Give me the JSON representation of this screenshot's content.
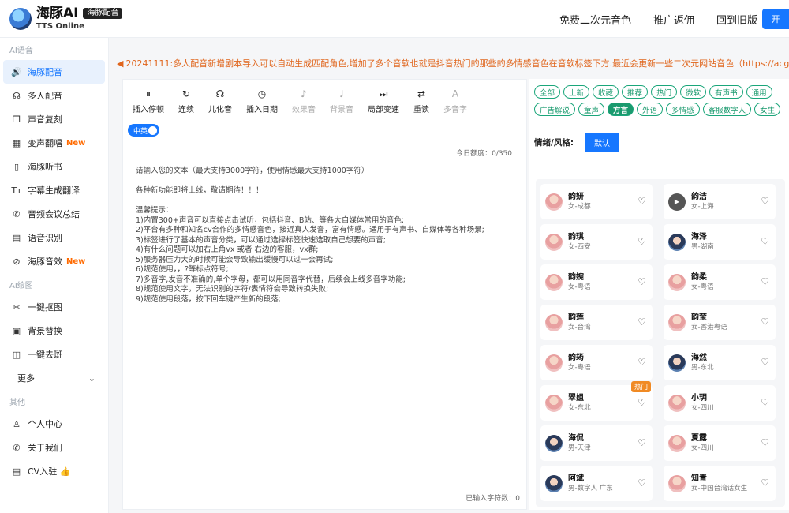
{
  "header": {
    "title": "海豚AI",
    "badge": "海豚配音",
    "subtitle": "TTS Online",
    "nav": [
      "免费二次元音色",
      "推广返佣",
      "回到旧版"
    ],
    "open_btn": "开"
  },
  "sidebar": {
    "sections": [
      {
        "title": "AI语音",
        "items": [
          {
            "label": "海豚配音",
            "icon": "🔊",
            "new": ""
          },
          {
            "label": "多人配音",
            "icon": "☊",
            "new": ""
          },
          {
            "label": "声音复刻",
            "icon": "❐",
            "new": ""
          },
          {
            "label": "变声翻唱",
            "icon": "▦",
            "new": "New"
          },
          {
            "label": "海豚听书",
            "icon": "▯",
            "new": ""
          },
          {
            "label": "字幕生成翻译",
            "icon": "Tт",
            "new": ""
          },
          {
            "label": "音频会议总结",
            "icon": "✆",
            "new": ""
          },
          {
            "label": "语音识别",
            "icon": "▤",
            "new": ""
          },
          {
            "label": "海豚音效",
            "icon": "⊘",
            "new": "New"
          }
        ]
      },
      {
        "title": "AI绘图",
        "items": [
          {
            "label": "一键抠图",
            "icon": "✂",
            "new": ""
          },
          {
            "label": "背景替换",
            "icon": "▣",
            "new": ""
          },
          {
            "label": "一键去斑",
            "icon": "◫",
            "new": ""
          }
        ]
      }
    ],
    "more_label": "更多",
    "other_title": "其他",
    "other_items": [
      {
        "label": "个人中心",
        "icon": "♙"
      },
      {
        "label": "关于我们",
        "icon": "✆"
      },
      {
        "label": "CV入驻 👍",
        "icon": "▤"
      }
    ]
  },
  "notice": "20241111:多人配音新增剧本导入可以自动生成匹配角色,增加了多个音软也就是抖音热门的那些的多情感音色在音软标签下方.最近会更新一些二次元网站音色（https://acgn.ttson.cn/），欢迎试用。",
  "toolbar": [
    {
      "icon": "⏸",
      "label": "插入停顿",
      "disabled": false
    },
    {
      "icon": "↻",
      "label": "连续",
      "disabled": false
    },
    {
      "icon": "☊",
      "label": "儿化音",
      "disabled": false
    },
    {
      "icon": "◷",
      "label": "插入日期",
      "disabled": false
    },
    {
      "icon": "♪",
      "label": "效果音",
      "disabled": true
    },
    {
      "icon": "♩",
      "label": "背景音",
      "disabled": true
    },
    {
      "icon": "⏭",
      "label": "局部变速",
      "disabled": false
    },
    {
      "icon": "⇄",
      "label": "重读",
      "disabled": false
    },
    {
      "icon": "A",
      "label": "多音字",
      "disabled": true
    }
  ],
  "switch_label": "中英",
  "quota": "今日额度：0/350",
  "textarea_content": "请输入您的文本（最大支持3000字符，使用情感最大支持1000字符）\n\n各种新功能即将上线，敬请期待！！！\n\n温馨提示：\n1)内置300+声音可以直接点击试听，包括抖音、B站、等各大自媒体常用的音色;\n2)平台有多种和知名cv合作的多情感音色，接近真人发音，富有情感。适用于有声书、自媒体等各种场景;\n3)标签进行了基本的声音分类，可以通过选择标签快速选取自己想要的声音;\n4)有什么问题可以加右上角vx 或者 右边的客服，vx群;\n5)服务器压力大的时候可能会导致输出缓慢可以过一会再试;\n6)规范使用，，?等标点符号;\n7)多音字,发音不准确的,单个字母，都可以用同音字代替，后续会上线多音字功能;\n8)规范使用文字，无法识别的字符/表情符会导致转换失败;\n9)规范使用段落，按下回车键产生新的段落;",
  "char_count": "已输入字符数：0",
  "tags": [
    {
      "label": "全部",
      "active": false
    },
    {
      "label": "上新",
      "active": false
    },
    {
      "label": "收藏",
      "active": false
    },
    {
      "label": "推荐",
      "active": false
    },
    {
      "label": "热门",
      "active": false
    },
    {
      "label": "微软",
      "active": false
    },
    {
      "label": "有声书",
      "active": false
    },
    {
      "label": "通用",
      "active": false
    },
    {
      "label": "广告解说",
      "active": false
    },
    {
      "label": "童声",
      "active": false
    },
    {
      "label": "方言",
      "active": true
    },
    {
      "label": "外语",
      "active": false
    },
    {
      "label": "多情感",
      "active": false
    },
    {
      "label": "客服数字人",
      "active": false
    },
    {
      "label": "女生",
      "active": false
    }
  ],
  "style_label": "情绪/风格:",
  "style_btn": "默认",
  "voices": [
    {
      "name": "韵妍",
      "desc": "女-成都",
      "gender": "f",
      "hot": "",
      "playing": false
    },
    {
      "name": "韵洁",
      "desc": "女-上海",
      "gender": "f",
      "hot": "",
      "playing": true
    },
    {
      "name": "韵琪",
      "desc": "女-西安",
      "gender": "f",
      "hot": "",
      "playing": false
    },
    {
      "name": "海泽",
      "desc": "男-湖南",
      "gender": "m",
      "hot": "",
      "playing": false
    },
    {
      "name": "韵婉",
      "desc": "女-粤语",
      "gender": "f",
      "hot": "",
      "playing": false
    },
    {
      "name": "韵柔",
      "desc": "女-粤语",
      "gender": "f",
      "hot": "",
      "playing": false
    },
    {
      "name": "韵莲",
      "desc": "女-台湾",
      "gender": "f",
      "hot": "",
      "playing": false
    },
    {
      "name": "韵莹",
      "desc": "女-香港粤语",
      "gender": "f",
      "hot": "",
      "playing": false
    },
    {
      "name": "韵筠",
      "desc": "女-粤语",
      "gender": "f",
      "hot": "",
      "playing": false
    },
    {
      "name": "海然",
      "desc": "男-东北",
      "gender": "m",
      "hot": "",
      "playing": false
    },
    {
      "name": "翠姐",
      "desc": "女-东北",
      "gender": "f",
      "hot": "热门",
      "playing": false
    },
    {
      "name": "小玥",
      "desc": "女-四川",
      "gender": "f",
      "hot": "",
      "playing": false
    },
    {
      "name": "海侃",
      "desc": "男-天津",
      "gender": "m",
      "hot": "",
      "playing": false
    },
    {
      "name": "夏露",
      "desc": "女-四川",
      "gender": "f",
      "hot": "",
      "playing": false
    },
    {
      "name": "阿斌",
      "desc": "男-数字人 广东",
      "gender": "m",
      "hot": "",
      "playing": false
    },
    {
      "name": "知青",
      "desc": "女-中国台湾话女生",
      "gender": "f",
      "hot": "",
      "playing": false
    }
  ]
}
